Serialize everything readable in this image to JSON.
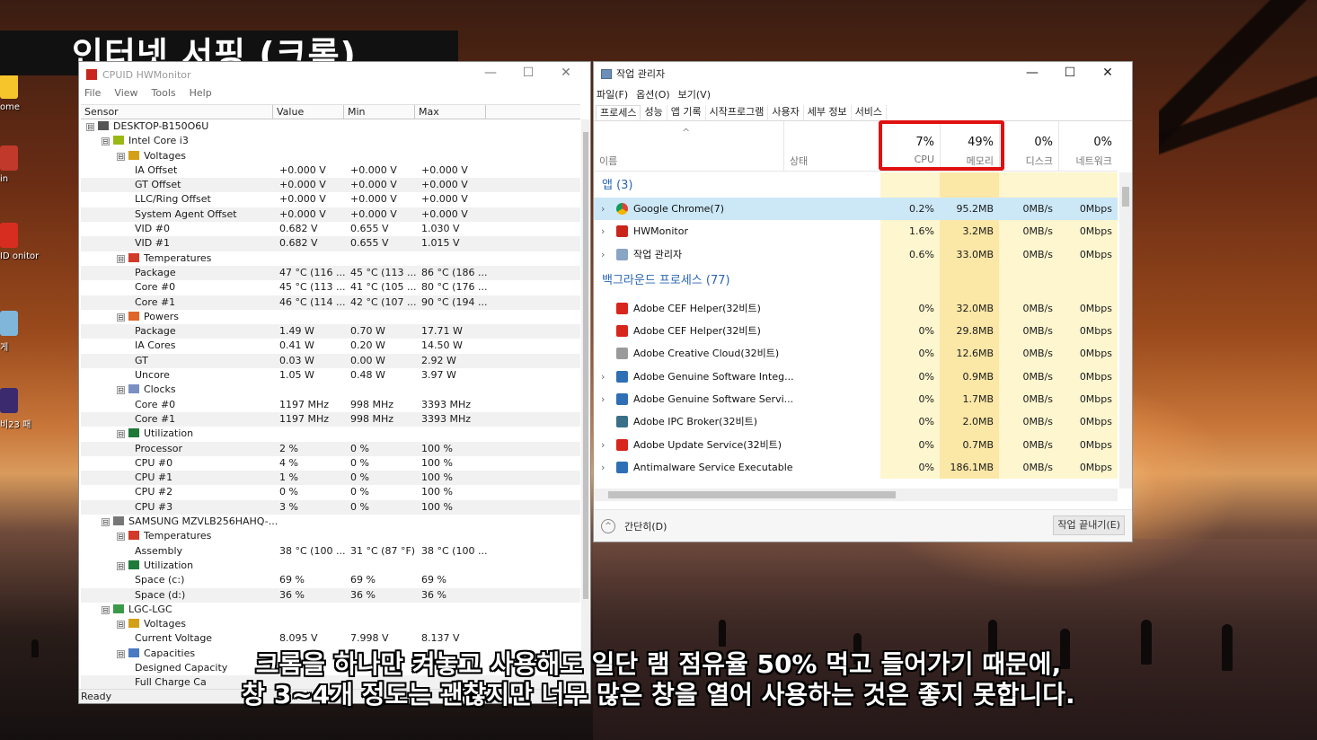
{
  "overlay": {
    "title": "인터넷 서핑 (크롬)",
    "subtitle_line1": "크롬을 하나만 켜놓고 사용해도 일단 램 점유율 50% 먹고 들어가기 때문에,",
    "subtitle_line2": "창 3~4개 정도는 괜찮지만 너무 많은 창을 열어 사용하는 것은 좋지 못합니다."
  },
  "desktop": {
    "icons": [
      {
        "label": "ome",
        "color": "#f6c52c"
      },
      {
        "label": "in",
        "color": "#c0392b"
      },
      {
        "label": "ID onitor",
        "color": "#d62d20"
      },
      {
        "label": "게",
        "color": "#7fb6d9"
      },
      {
        "label": "비23 패",
        "color": "#3b2a6e"
      }
    ]
  },
  "hwmonitor": {
    "title": "CPUID HWMonitor",
    "window_controls": [
      "—",
      "☐",
      "✕"
    ],
    "menu": [
      "File",
      "View",
      "Tools",
      "Help"
    ],
    "columns": [
      "Sensor",
      "Value",
      "Min",
      "Max"
    ],
    "status": "Ready",
    "rows": [
      {
        "level": 0,
        "toggle": "⊟",
        "icon": "computer",
        "name": "DESKTOP-B150O6U",
        "v": "",
        "mn": "",
        "mx": ""
      },
      {
        "level": 1,
        "toggle": "⊟",
        "icon": "chip",
        "name": "Intel Core i3",
        "v": "",
        "mn": "",
        "mx": ""
      },
      {
        "level": 2,
        "toggle": "⊟",
        "icon": "voltage",
        "name": "Voltages",
        "v": "",
        "mn": "",
        "mx": ""
      },
      {
        "level": 3,
        "name": "IA Offset",
        "v": "+0.000 V",
        "mn": "+0.000 V",
        "mx": "+0.000 V"
      },
      {
        "level": 3,
        "name": "GT Offset",
        "v": "+0.000 V",
        "mn": "+0.000 V",
        "mx": "+0.000 V"
      },
      {
        "level": 3,
        "name": "LLC/Ring Offset",
        "v": "+0.000 V",
        "mn": "+0.000 V",
        "mx": "+0.000 V"
      },
      {
        "level": 3,
        "name": "System Agent Offset",
        "v": "+0.000 V",
        "mn": "+0.000 V",
        "mx": "+0.000 V"
      },
      {
        "level": 3,
        "name": "VID #0",
        "v": "0.682 V",
        "mn": "0.655 V",
        "mx": "1.030 V"
      },
      {
        "level": 3,
        "name": "VID #1",
        "v": "0.682 V",
        "mn": "0.655 V",
        "mx": "1.015 V"
      },
      {
        "level": 2,
        "toggle": "⊟",
        "icon": "temperature",
        "name": "Temperatures",
        "v": "",
        "mn": "",
        "mx": ""
      },
      {
        "level": 3,
        "name": "Package",
        "v": "47 °C  (116 ...",
        "mn": "45 °C  (113 ...",
        "mx": "86 °C  (186 ..."
      },
      {
        "level": 3,
        "name": "Core #0",
        "v": "45 °C  (113 ...",
        "mn": "41 °C  (105 ...",
        "mx": "80 °C  (176 ..."
      },
      {
        "level": 3,
        "name": "Core #1",
        "v": "46 °C  (114 ...",
        "mn": "42 °C  (107 ...",
        "mx": "90 °C  (194 ..."
      },
      {
        "level": 2,
        "toggle": "⊟",
        "icon": "power",
        "name": "Powers",
        "v": "",
        "mn": "",
        "mx": ""
      },
      {
        "level": 3,
        "name": "Package",
        "v": "1.49 W",
        "mn": "0.70 W",
        "mx": "17.71 W"
      },
      {
        "level": 3,
        "name": "IA Cores",
        "v": "0.41 W",
        "mn": "0.20 W",
        "mx": "14.50 W"
      },
      {
        "level": 3,
        "name": "GT",
        "v": "0.03 W",
        "mn": "0.00 W",
        "mx": "2.92 W"
      },
      {
        "level": 3,
        "name": "Uncore",
        "v": "1.05 W",
        "mn": "0.48 W",
        "mx": "3.97 W"
      },
      {
        "level": 2,
        "toggle": "⊟",
        "icon": "clock",
        "name": "Clocks",
        "v": "",
        "mn": "",
        "mx": ""
      },
      {
        "level": 3,
        "name": "Core #0",
        "v": "1197 MHz",
        "mn": "998 MHz",
        "mx": "3393 MHz"
      },
      {
        "level": 3,
        "name": "Core #1",
        "v": "1197 MHz",
        "mn": "998 MHz",
        "mx": "3393 MHz"
      },
      {
        "level": 2,
        "toggle": "⊟",
        "icon": "utilization",
        "name": "Utilization",
        "v": "",
        "mn": "",
        "mx": ""
      },
      {
        "level": 3,
        "name": "Processor",
        "v": "2 %",
        "mn": "0 %",
        "mx": "100 %"
      },
      {
        "level": 3,
        "name": "CPU #0",
        "v": "4 %",
        "mn": "0 %",
        "mx": "100 %"
      },
      {
        "level": 3,
        "name": "CPU #1",
        "v": "1 %",
        "mn": "0 %",
        "mx": "100 %"
      },
      {
        "level": 3,
        "name": "CPU #2",
        "v": "0 %",
        "mn": "0 %",
        "mx": "100 %"
      },
      {
        "level": 3,
        "name": "CPU #3",
        "v": "3 %",
        "mn": "0 %",
        "mx": "100 %"
      },
      {
        "level": 1,
        "toggle": "⊟",
        "icon": "disk",
        "name": "SAMSUNG MZVLB256HAHQ-...",
        "v": "",
        "mn": "",
        "mx": ""
      },
      {
        "level": 2,
        "toggle": "⊟",
        "icon": "temperature",
        "name": "Temperatures",
        "v": "",
        "mn": "",
        "mx": ""
      },
      {
        "level": 3,
        "name": "Assembly",
        "v": "38 °C  (100 ...",
        "mn": "31 °C  (87 °F)",
        "mx": "38 °C  (100 ..."
      },
      {
        "level": 2,
        "toggle": "⊟",
        "icon": "utilization",
        "name": "Utilization",
        "v": "",
        "mn": "",
        "mx": ""
      },
      {
        "level": 3,
        "name": "Space (c:)",
        "v": "69 %",
        "mn": "69 %",
        "mx": "69 %"
      },
      {
        "level": 3,
        "name": "Space (d:)",
        "v": "36 %",
        "mn": "36 %",
        "mx": "36 %"
      },
      {
        "level": 1,
        "toggle": "⊟",
        "icon": "battery",
        "name": "LGC-LGC",
        "v": "",
        "mn": "",
        "mx": ""
      },
      {
        "level": 2,
        "toggle": "⊟",
        "icon": "voltage",
        "name": "Voltages",
        "v": "",
        "mn": "",
        "mx": ""
      },
      {
        "level": 3,
        "name": "Current Voltage",
        "v": "8.095 V",
        "mn": "7.998 V",
        "mx": "8.137 V"
      },
      {
        "level": 2,
        "toggle": "⊟",
        "icon": "capacity",
        "name": "Capacities",
        "v": "",
        "mn": "",
        "mx": ""
      },
      {
        "level": 3,
        "name": "Designed Capacity",
        "v": "",
        "mn": "",
        "mx": ""
      },
      {
        "level": 3,
        "name": "Full Charge Ca",
        "v": "",
        "mn": "",
        "mx": ""
      }
    ]
  },
  "taskmanager": {
    "title": "작업 관리자",
    "window_controls": [
      "—",
      "☐",
      "✕"
    ],
    "menu": [
      "파일(F)",
      "옵션(O)",
      "보기(V)"
    ],
    "tabs": [
      "프로세스",
      "성능",
      "앱 기록",
      "시작프로그램",
      "사용자",
      "세부 정보",
      "서비스"
    ],
    "active_tab": 0,
    "sort_arrow": "^",
    "col_name": "이름",
    "col_status": "상태",
    "cols": [
      {
        "pct": "7%",
        "label": "CPU"
      },
      {
        "pct": "49%",
        "label": "메모리"
      },
      {
        "pct": "0%",
        "label": "디스크"
      },
      {
        "pct": "0%",
        "label": "네트워크"
      }
    ],
    "groups": [
      {
        "title": "앱 (3)",
        "rows": [
          {
            "name": "Google Chrome(7)",
            "expand": "›",
            "icon": "chrome",
            "color": "#e8453c",
            "cpu": "0.2%",
            "mem": "95.2MB",
            "disk": "0MB/s",
            "net": "0Mbps",
            "selected": true
          },
          {
            "name": "HWMonitor",
            "expand": "›",
            "icon": "hwmonitor",
            "color": "#c8261d",
            "cpu": "1.6%",
            "mem": "3.2MB",
            "disk": "0MB/s",
            "net": "0Mbps",
            "selected": false
          },
          {
            "name": "작업 관리자",
            "expand": "›",
            "icon": "taskmgr",
            "color": "#8aa4c4",
            "cpu": "0.6%",
            "mem": "33.0MB",
            "disk": "0MB/s",
            "net": "0Mbps",
            "selected": false
          }
        ]
      },
      {
        "title": "백그라운드 프로세스 (77)",
        "rows": [
          {
            "name": "Adobe CEF Helper(32비트)",
            "expand": "",
            "icon": "adobe",
            "color": "#d8261d",
            "cpu": "0%",
            "mem": "32.0MB",
            "disk": "0MB/s",
            "net": "0Mbps",
            "selected": false
          },
          {
            "name": "Adobe CEF Helper(32비트)",
            "expand": "",
            "icon": "adobe",
            "color": "#d8261d",
            "cpu": "0%",
            "mem": "29.8MB",
            "disk": "0MB/s",
            "net": "0Mbps",
            "selected": false
          },
          {
            "name": "Adobe Creative Cloud(32비트)",
            "expand": "",
            "icon": "creative-cloud",
            "color": "#9a9a9a",
            "cpu": "0%",
            "mem": "12.6MB",
            "disk": "0MB/s",
            "net": "0Mbps",
            "selected": false
          },
          {
            "name": "Adobe Genuine Software Integ...",
            "expand": "›",
            "icon": "service",
            "color": "#2f6fb5",
            "cpu": "0%",
            "mem": "0.9MB",
            "disk": "0MB/s",
            "net": "0Mbps",
            "selected": false
          },
          {
            "name": "Adobe Genuine Software Servi...",
            "expand": "›",
            "icon": "service",
            "color": "#2f6fb5",
            "cpu": "0%",
            "mem": "1.7MB",
            "disk": "0MB/s",
            "net": "0Mbps",
            "selected": false
          },
          {
            "name": "Adobe IPC Broker(32비트)",
            "expand": "",
            "icon": "app",
            "color": "#3a6f8a",
            "cpu": "0%",
            "mem": "2.0MB",
            "disk": "0MB/s",
            "net": "0Mbps",
            "selected": false
          },
          {
            "name": "Adobe Update Service(32비트)",
            "expand": "›",
            "icon": "adobe",
            "color": "#d8261d",
            "cpu": "0%",
            "mem": "0.7MB",
            "disk": "0MB/s",
            "net": "0Mbps",
            "selected": false
          },
          {
            "name": "Antimalware Service Executable",
            "expand": "›",
            "icon": "service",
            "color": "#2f6fb5",
            "cpu": "0%",
            "mem": "186.1MB",
            "disk": "0MB/s",
            "net": "0Mbps",
            "selected": false
          }
        ]
      }
    ],
    "footer": {
      "fewer": "간단히(D)",
      "fewer_icon": "^",
      "end_task": "작업 끝내기(E)"
    }
  }
}
